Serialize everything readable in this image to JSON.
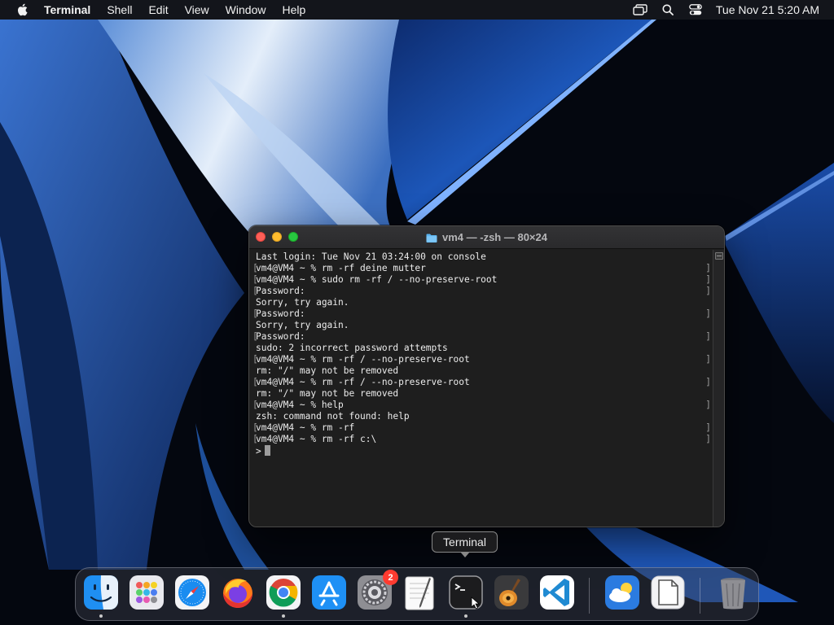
{
  "menubar": {
    "apple_icon": "apple-logo-icon",
    "app_name": "Terminal",
    "menus": [
      "Shell",
      "Edit",
      "View",
      "Window",
      "Help"
    ],
    "status_icons": [
      "screen-mirroring-icon",
      "spotlight-search-icon",
      "control-center-icon"
    ],
    "clock": "Tue Nov 21  5:20 AM"
  },
  "terminal": {
    "title": "vm4 — -zsh — 80×24",
    "title_icon": "folder-icon",
    "lines": [
      {
        "text": "Last login: Tue Nov 21 03:24:00 on console",
        "mark": false
      },
      {
        "text": "vm4@VM4 ~ % rm -rf deine mutter",
        "mark": true
      },
      {
        "text": "vm4@VM4 ~ % sudo rm -rf / --no-preserve-root",
        "mark": true
      },
      {
        "text": "Password:",
        "mark": true
      },
      {
        "text": "Sorry, try again.",
        "mark": false
      },
      {
        "text": "Password:",
        "mark": true
      },
      {
        "text": "Sorry, try again.",
        "mark": false
      },
      {
        "text": "Password:",
        "mark": true
      },
      {
        "text": "sudo: 2 incorrect password attempts",
        "mark": false
      },
      {
        "text": "vm4@VM4 ~ % rm -rf / --no-preserve-root",
        "mark": true
      },
      {
        "text": "rm: \"/\" may not be removed",
        "mark": false
      },
      {
        "text": "vm4@VM4 ~ % rm -rf / --no-preserve-root",
        "mark": true
      },
      {
        "text": "rm: \"/\" may not be removed",
        "mark": false
      },
      {
        "text": "vm4@VM4 ~ % help",
        "mark": true
      },
      {
        "text": "zsh: command not found: help",
        "mark": false
      },
      {
        "text": "vm4@VM4 ~ % rm -rf",
        "mark": true
      },
      {
        "text": "vm4@VM4 ~ % rm -rf c:\\",
        "mark": true
      }
    ],
    "prompt": ">",
    "mark_left": "[",
    "mark_right": "]"
  },
  "tooltip": {
    "label": "Terminal"
  },
  "dock": {
    "items": [
      {
        "name": "Finder",
        "icon": "finder-icon",
        "running": true
      },
      {
        "name": "Launchpad",
        "icon": "launchpad-icon",
        "running": false
      },
      {
        "name": "Safari",
        "icon": "safari-icon",
        "running": false
      },
      {
        "name": "Firefox",
        "icon": "firefox-icon",
        "running": false
      },
      {
        "name": "Google Chrome",
        "icon": "chrome-icon",
        "running": true
      },
      {
        "name": "App Store",
        "icon": "app-store-icon",
        "running": false
      },
      {
        "name": "System Settings",
        "icon": "system-settings-icon",
        "running": false,
        "badge": "2"
      },
      {
        "name": "TextEdit",
        "icon": "textedit-icon",
        "running": false
      },
      {
        "name": "Terminal",
        "icon": "terminal-icon",
        "running": true
      },
      {
        "name": "GarageBand",
        "icon": "garageband-icon",
        "running": false
      },
      {
        "name": "Visual Studio Code",
        "icon": "vscode-icon",
        "running": false
      },
      {
        "name": "Weather",
        "icon": "weather-icon",
        "running": false
      },
      {
        "name": "Preview",
        "icon": "preview-document-icon",
        "running": false
      },
      {
        "name": "Trash",
        "icon": "trash-icon",
        "running": false
      }
    ],
    "running_dot_color": "#c8c8c8",
    "badge_color": "#ff3b30"
  }
}
